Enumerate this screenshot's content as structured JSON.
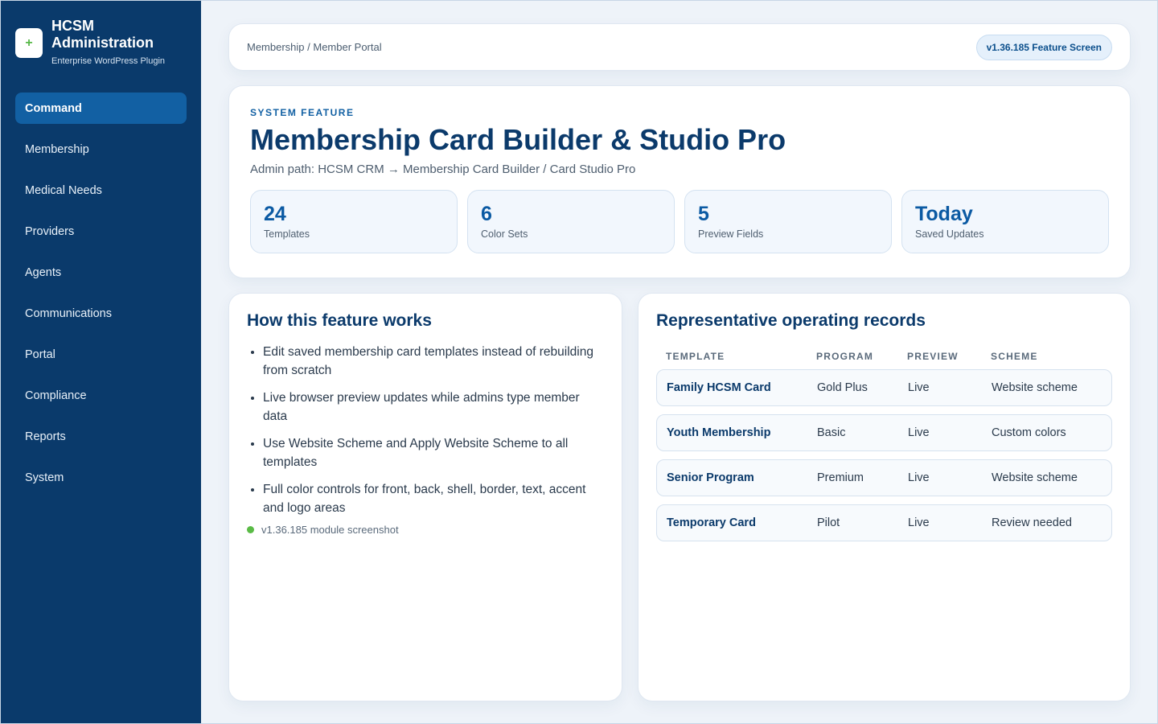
{
  "brand": {
    "title": "HCSM Administration",
    "subtitle": "Enterprise WordPress Plugin",
    "logo_glyph": "+"
  },
  "sidebar": {
    "items": [
      {
        "label": "Command",
        "active": true
      },
      {
        "label": "Membership"
      },
      {
        "label": "Medical Needs"
      },
      {
        "label": "Providers"
      },
      {
        "label": "Agents"
      },
      {
        "label": "Communications"
      },
      {
        "label": "Portal"
      },
      {
        "label": "Compliance"
      },
      {
        "label": "Reports"
      },
      {
        "label": "System"
      }
    ]
  },
  "header": {
    "breadcrumb": "Membership / Member Portal",
    "version_badge": "v1.36.185 Feature Screen"
  },
  "hero": {
    "eyebrow": "SYSTEM FEATURE",
    "title": "Membership Card Builder & Studio Pro",
    "admin_path": "Admin path: HCSM CRM → Membership Card Builder / Card Studio Pro",
    "stats": [
      {
        "value": "24",
        "label": "Templates"
      },
      {
        "value": "6",
        "label": "Color Sets"
      },
      {
        "value": "5",
        "label": "Preview Fields"
      },
      {
        "value": "Today",
        "label": "Saved Updates"
      }
    ]
  },
  "how": {
    "title": "How this feature works",
    "bullets": [
      "Edit saved membership card templates instead of rebuilding from scratch",
      "Live browser preview updates while admins type member data",
      "Use Website Scheme and Apply Website Scheme to all templates",
      "Full color controls for front, back, shell, border, text, accent and logo areas"
    ],
    "status": "v1.36.185 module screenshot"
  },
  "records": {
    "title": "Representative operating records",
    "columns": [
      "TEMPLATE",
      "PROGRAM",
      "PREVIEW",
      "SCHEME"
    ],
    "rows": [
      [
        "Family HCSM Card",
        "Gold Plus",
        "Live",
        "Website scheme"
      ],
      [
        "Youth Membership",
        "Basic",
        "Live",
        "Custom colors"
      ],
      [
        "Senior Program",
        "Premium",
        "Live",
        "Website scheme"
      ],
      [
        "Temporary Card",
        "Pilot",
        "Live",
        "Review needed"
      ]
    ]
  },
  "colors": {
    "sidebar_bg": "#0a3a6b",
    "active_nav": "#1260a3",
    "accent_green": "#5abb46",
    "title_navy": "#0b3a6b"
  }
}
